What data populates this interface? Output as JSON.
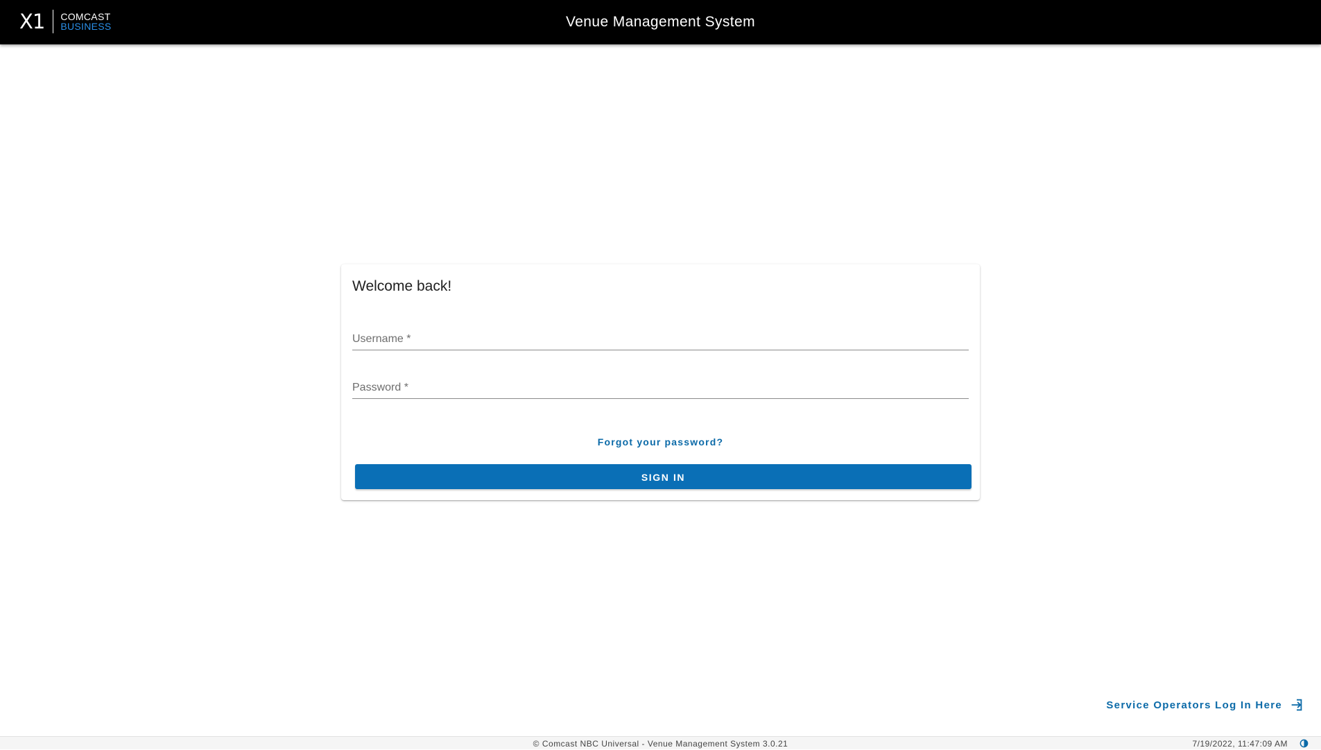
{
  "header": {
    "logo": {
      "mark": "X1",
      "line1": "COMCAST",
      "line2": "BUSINESS"
    },
    "title": "Venue Management System"
  },
  "login": {
    "title": "Welcome back!",
    "username_label": "Username *",
    "password_label": "Password *",
    "forgot_password": "Forgot your password?",
    "sign_in": "SIGN IN"
  },
  "operator_link": {
    "label": "Service Operators Log In Here",
    "icon": "login-icon"
  },
  "footer": {
    "copyright": "© Comcast NBC Universal - Venue Management System 3.0.21",
    "timestamp": "7/19/2022, 11:47:09 AM",
    "contrast_icon": "contrast-icon"
  },
  "colors": {
    "header_bg": "#000000",
    "accent": "#0a6fb6",
    "link": "#0b6aa8",
    "logo_business": "#2a8fe8"
  }
}
